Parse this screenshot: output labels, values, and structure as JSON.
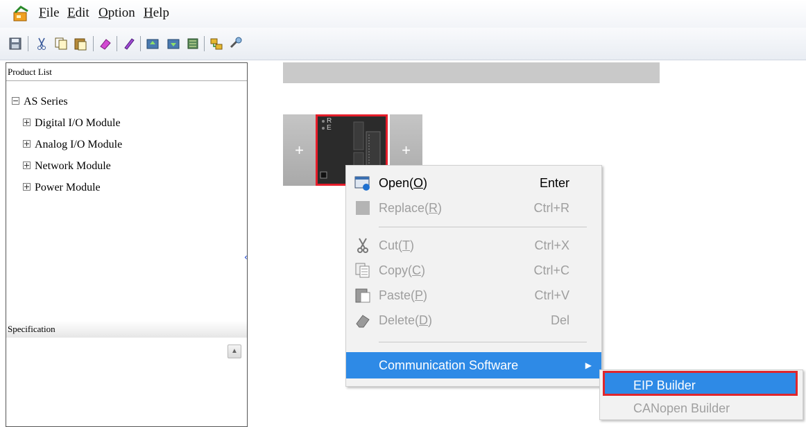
{
  "menubar": {
    "items": [
      {
        "label": "File",
        "underline": "F",
        "rest": "ile"
      },
      {
        "label": "Edit",
        "underline": "E",
        "rest": "dit"
      },
      {
        "label": "Option",
        "underline": "O",
        "rest": "ption"
      },
      {
        "label": "Help",
        "underline": "H",
        "rest": "elp"
      }
    ]
  },
  "toolbar": {
    "icons": [
      "save-icon",
      "cut-icon",
      "copy-icon",
      "paste-icon",
      "eraser-icon",
      "pen-icon",
      "upload-icon",
      "download-icon",
      "scan-icon",
      "network-icon",
      "tool-icon"
    ]
  },
  "left_panel": {
    "title": "Product List",
    "tree": {
      "root": "AS Series",
      "children": [
        "Digital I/O Module",
        "Analog I/O Module",
        "Network Module",
        "Power Module"
      ]
    },
    "spec_title": "Specification"
  },
  "rack": {
    "left_slot": "+",
    "right_slot": "+",
    "cpu_leds": [
      "R",
      "E"
    ]
  },
  "context_menu": {
    "open": {
      "label": "Open(",
      "mnemonic": "O",
      "tail": ")",
      "shortcut": "Enter"
    },
    "replace": {
      "label": "Replace(",
      "mnemonic": "R",
      "tail": ")",
      "shortcut": "Ctrl+R"
    },
    "cut": {
      "label": "Cut(",
      "mnemonic": "T",
      "tail": ")",
      "shortcut": "Ctrl+X"
    },
    "copy": {
      "label": "Copy(",
      "mnemonic": "C",
      "tail": ")",
      "shortcut": "Ctrl+C"
    },
    "paste": {
      "label": "Paste(",
      "mnemonic": "P",
      "tail": ")",
      "shortcut": "Ctrl+V"
    },
    "delete": {
      "label": "Delete(",
      "mnemonic": "D",
      "tail": ")",
      "shortcut": "Del"
    },
    "communication": {
      "label": "Communication Software",
      "arrow": "▶"
    }
  },
  "submenu": {
    "eip": "EIP Builder",
    "canopen": "CANopen Builder"
  },
  "colors": {
    "highlight": "#2e8ae6",
    "outline_red": "#e0262c",
    "disabled_text": "#9e9e9e"
  }
}
